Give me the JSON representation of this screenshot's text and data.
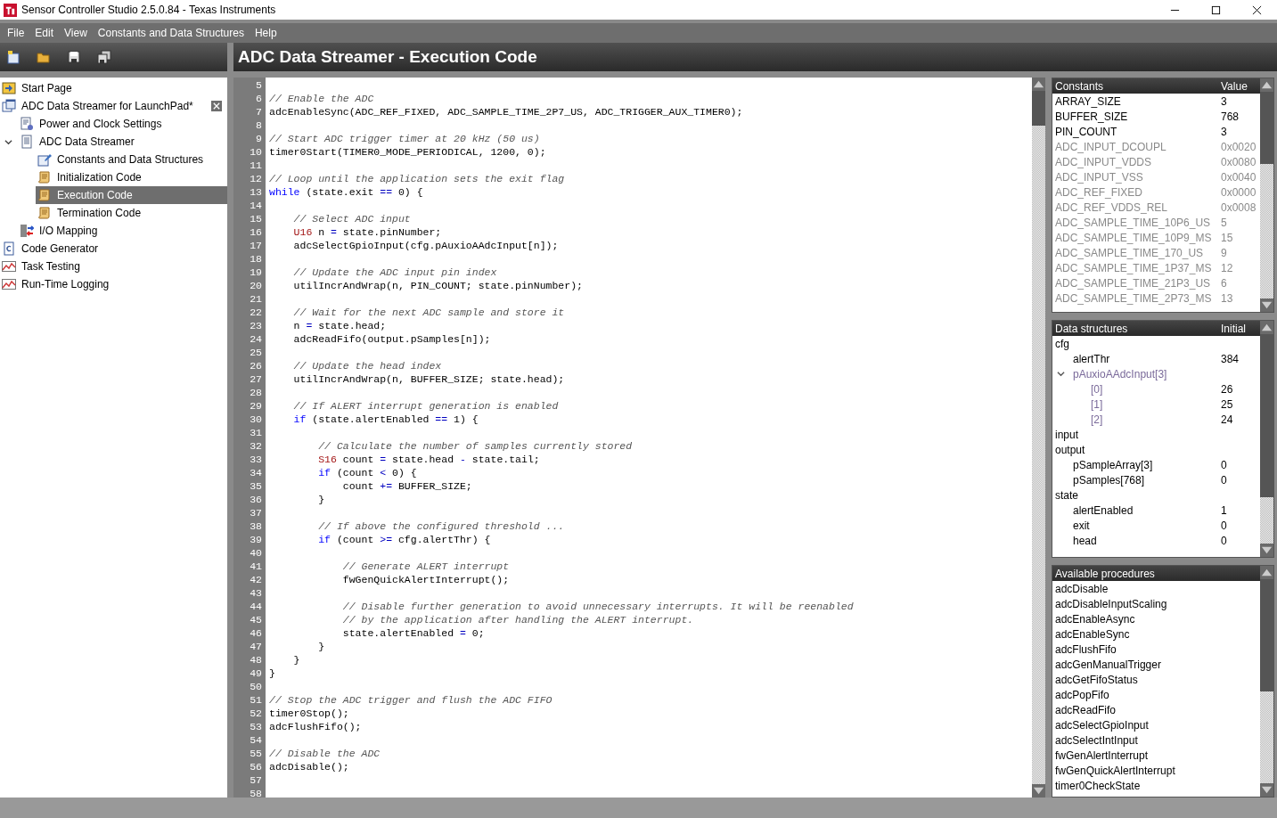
{
  "window": {
    "title": "Sensor Controller Studio 2.5.0.84 - Texas Instruments"
  },
  "menu": [
    "File",
    "Edit",
    "View",
    "Constants and Data Structures",
    "Help"
  ],
  "editor_title": "ADC Data Streamer - Execution Code",
  "project_tree": [
    {
      "label": "Start Page",
      "kind": "page",
      "selected": false
    },
    {
      "label": "ADC Data Streamer for LaunchPad*",
      "kind": "project",
      "selected": false,
      "closable": true,
      "children": [
        {
          "label": "Power and Clock Settings",
          "kind": "settings",
          "selected": false
        },
        {
          "label": "ADC Data Streamer",
          "kind": "task",
          "selected": false,
          "expanded": true,
          "children": [
            {
              "label": "Constants and Data Structures",
              "kind": "constants",
              "selected": false
            },
            {
              "label": "Initialization Code",
              "kind": "code",
              "selected": false
            },
            {
              "label": "Execution Code",
              "kind": "code",
              "selected": true
            },
            {
              "label": "Termination Code",
              "kind": "code",
              "selected": false
            }
          ]
        },
        {
          "label": "I/O Mapping",
          "kind": "mapping",
          "selected": false
        }
      ]
    },
    {
      "label": "Code Generator",
      "kind": "generator",
      "selected": false
    },
    {
      "label": "Task Testing",
      "kind": "chart",
      "selected": false
    },
    {
      "label": "Run-Time Logging",
      "kind": "chart",
      "selected": false
    }
  ],
  "code_lines": [
    {
      "n": "5"
    },
    {
      "n": "6",
      "segs": [
        {
          "kind": "comment",
          "text": "// Enable the ADC"
        }
      ]
    },
    {
      "n": "7",
      "segs": [
        {
          "kind": "plain",
          "text": "adcEnableSync(ADC_REF_FIXED, ADC_SAMPLE_TIME_2P7_US, ADC_TRIGGER_AUX_TIMER0);"
        }
      ]
    },
    {
      "n": "8"
    },
    {
      "n": "9",
      "segs": [
        {
          "kind": "comment",
          "text": "// Start ADC trigger timer at 20 kHz (50 us)"
        }
      ]
    },
    {
      "n": "10",
      "segs": [
        {
          "kind": "plain",
          "text": "timer0Start(TIMER0_MODE_PERIODICAL, 1200, 0);"
        }
      ]
    },
    {
      "n": "11"
    },
    {
      "n": "12",
      "segs": [
        {
          "kind": "comment",
          "text": "// Loop until the application sets the exit flag"
        }
      ]
    },
    {
      "n": "13",
      "segs": [
        {
          "kind": "keyword",
          "text": "while"
        },
        {
          "kind": "plain",
          "text": " (state.exit "
        },
        {
          "kind": "operator",
          "text": "=="
        },
        {
          "kind": "plain",
          "text": " 0) {"
        }
      ]
    },
    {
      "n": "14"
    },
    {
      "n": "15",
      "segs": [
        {
          "kind": "comment",
          "text": "    // Select ADC input"
        }
      ]
    },
    {
      "n": "16",
      "segs": [
        {
          "kind": "type",
          "text": "    U16"
        },
        {
          "kind": "plain",
          "text": " n "
        },
        {
          "kind": "operator",
          "text": "="
        },
        {
          "kind": "plain",
          "text": " state.pinNumber;"
        }
      ]
    },
    {
      "n": "17",
      "segs": [
        {
          "kind": "plain",
          "text": "    adcSelectGpioInput(cfg.pAuxioAAdcInput[n]);"
        }
      ]
    },
    {
      "n": "18"
    },
    {
      "n": "19",
      "segs": [
        {
          "kind": "comment",
          "text": "    // Update the ADC input pin index"
        }
      ]
    },
    {
      "n": "20",
      "segs": [
        {
          "kind": "plain",
          "text": "    utilIncrAndWrap(n, PIN_COUNT; state.pinNumber);"
        }
      ]
    },
    {
      "n": "21"
    },
    {
      "n": "22",
      "segs": [
        {
          "kind": "comment",
          "text": "    // Wait for the next ADC sample and store it"
        }
      ]
    },
    {
      "n": "23",
      "segs": [
        {
          "kind": "plain",
          "text": "    n "
        },
        {
          "kind": "operator",
          "text": "="
        },
        {
          "kind": "plain",
          "text": " state.head;"
        }
      ]
    },
    {
      "n": "24",
      "segs": [
        {
          "kind": "plain",
          "text": "    adcReadFifo(output.pSamples[n]);"
        }
      ]
    },
    {
      "n": "25"
    },
    {
      "n": "26",
      "segs": [
        {
          "kind": "comment",
          "text": "    // Update the head index"
        }
      ]
    },
    {
      "n": "27",
      "segs": [
        {
          "kind": "plain",
          "text": "    utilIncrAndWrap(n, BUFFER_SIZE; state.head);"
        }
      ]
    },
    {
      "n": "28"
    },
    {
      "n": "29",
      "segs": [
        {
          "kind": "comment",
          "text": "    // If ALERT interrupt generation is enabled"
        }
      ]
    },
    {
      "n": "30",
      "segs": [
        {
          "kind": "keyword",
          "text": "    if"
        },
        {
          "kind": "plain",
          "text": " (state.alertEnabled "
        },
        {
          "kind": "operator",
          "text": "=="
        },
        {
          "kind": "plain",
          "text": " 1) {"
        }
      ]
    },
    {
      "n": "31"
    },
    {
      "n": "32",
      "segs": [
        {
          "kind": "comment",
          "text": "        // Calculate the number of samples currently stored"
        }
      ]
    },
    {
      "n": "33",
      "segs": [
        {
          "kind": "type",
          "text": "        S16"
        },
        {
          "kind": "plain",
          "text": " count "
        },
        {
          "kind": "operator",
          "text": "="
        },
        {
          "kind": "plain",
          "text": " state.head "
        },
        {
          "kind": "operator",
          "text": "-"
        },
        {
          "kind": "plain",
          "text": " state.tail;"
        }
      ]
    },
    {
      "n": "34",
      "segs": [
        {
          "kind": "keyword",
          "text": "        if"
        },
        {
          "kind": "plain",
          "text": " (count "
        },
        {
          "kind": "operator",
          "text": "<"
        },
        {
          "kind": "plain",
          "text": " 0) {"
        }
      ]
    },
    {
      "n": "35",
      "segs": [
        {
          "kind": "plain",
          "text": "            count "
        },
        {
          "kind": "operator",
          "text": "+="
        },
        {
          "kind": "plain",
          "text": " BUFFER_SIZE;"
        }
      ]
    },
    {
      "n": "36",
      "segs": [
        {
          "kind": "plain",
          "text": "        }"
        }
      ]
    },
    {
      "n": "37"
    },
    {
      "n": "38",
      "segs": [
        {
          "kind": "comment",
          "text": "        // If above the configured threshold ..."
        }
      ]
    },
    {
      "n": "39",
      "segs": [
        {
          "kind": "keyword",
          "text": "        if"
        },
        {
          "kind": "plain",
          "text": " (count "
        },
        {
          "kind": "operator",
          "text": ">="
        },
        {
          "kind": "plain",
          "text": " cfg.alertThr) {"
        }
      ]
    },
    {
      "n": "40"
    },
    {
      "n": "41",
      "segs": [
        {
          "kind": "comment",
          "text": "            // Generate ALERT interrupt"
        }
      ]
    },
    {
      "n": "42",
      "segs": [
        {
          "kind": "plain",
          "text": "            fwGenQuickAlertInterrupt();"
        }
      ]
    },
    {
      "n": "43"
    },
    {
      "n": "44",
      "segs": [
        {
          "kind": "comment",
          "text": "            // Disable further generation to avoid unnecessary interrupts. It will be reenabled"
        }
      ]
    },
    {
      "n": "45",
      "segs": [
        {
          "kind": "comment",
          "text": "            // by the application after handling the ALERT interrupt."
        }
      ]
    },
    {
      "n": "46",
      "segs": [
        {
          "kind": "plain",
          "text": "            state.alertEnabled "
        },
        {
          "kind": "operator",
          "text": "="
        },
        {
          "kind": "plain",
          "text": " 0;"
        }
      ]
    },
    {
      "n": "47",
      "segs": [
        {
          "kind": "plain",
          "text": "        }"
        }
      ]
    },
    {
      "n": "48",
      "segs": [
        {
          "kind": "plain",
          "text": "    }"
        }
      ]
    },
    {
      "n": "49",
      "segs": [
        {
          "kind": "plain",
          "text": "}"
        }
      ]
    },
    {
      "n": "50"
    },
    {
      "n": "51",
      "segs": [
        {
          "kind": "comment",
          "text": "// Stop the ADC trigger and flush the ADC FIFO"
        }
      ]
    },
    {
      "n": "52",
      "segs": [
        {
          "kind": "plain",
          "text": "timer0Stop();"
        }
      ]
    },
    {
      "n": "53",
      "segs": [
        {
          "kind": "plain",
          "text": "adcFlushFifo();"
        }
      ]
    },
    {
      "n": "54"
    },
    {
      "n": "55",
      "segs": [
        {
          "kind": "comment",
          "text": "// Disable the ADC"
        }
      ]
    },
    {
      "n": "56",
      "segs": [
        {
          "kind": "plain",
          "text": "adcDisable();"
        }
      ]
    },
    {
      "n": "57"
    },
    {
      "n": "58"
    }
  ],
  "constants": {
    "columns": [
      "Constants",
      "Value"
    ],
    "rows": [
      {
        "name": "ARRAY_SIZE",
        "value": "3",
        "builtin": false
      },
      {
        "name": "BUFFER_SIZE",
        "value": "768",
        "builtin": false
      },
      {
        "name": "PIN_COUNT",
        "value": "3",
        "builtin": false
      },
      {
        "name": "ADC_INPUT_DCOUPL",
        "value": "0x0020",
        "builtin": true
      },
      {
        "name": "ADC_INPUT_VDDS",
        "value": "0x0080",
        "builtin": true
      },
      {
        "name": "ADC_INPUT_VSS",
        "value": "0x0040",
        "builtin": true
      },
      {
        "name": "ADC_REF_FIXED",
        "value": "0x0000",
        "builtin": true
      },
      {
        "name": "ADC_REF_VDDS_REL",
        "value": "0x0008",
        "builtin": true
      },
      {
        "name": "ADC_SAMPLE_TIME_10P6_US",
        "value": "5",
        "builtin": true
      },
      {
        "name": "ADC_SAMPLE_TIME_10P9_MS",
        "value": "15",
        "builtin": true
      },
      {
        "name": "ADC_SAMPLE_TIME_170_US",
        "value": "9",
        "builtin": true
      },
      {
        "name": "ADC_SAMPLE_TIME_1P37_MS",
        "value": "12",
        "builtin": true
      },
      {
        "name": "ADC_SAMPLE_TIME_21P3_US",
        "value": "6",
        "builtin": true
      },
      {
        "name": "ADC_SAMPLE_TIME_2P73_MS",
        "value": "13",
        "builtin": true
      }
    ]
  },
  "data_structures": {
    "columns": [
      "Data structures",
      "Initial"
    ],
    "nodes": [
      {
        "name": "cfg",
        "dimmed": false,
        "children": [
          {
            "name": "alertThr",
            "value": "384",
            "dimmed": false
          },
          {
            "name": "pAuxioAAdcInput[3]",
            "dimmed": true,
            "expanded": true,
            "children": [
              {
                "name": "[0]",
                "value": "26",
                "dimmed": true
              },
              {
                "name": "[1]",
                "value": "25",
                "dimmed": true
              },
              {
                "name": "[2]",
                "value": "24",
                "dimmed": true
              }
            ]
          }
        ]
      },
      {
        "name": "input",
        "dimmed": false
      },
      {
        "name": "output",
        "dimmed": false,
        "children": [
          {
            "name": "pSampleArray[3]",
            "value": "0",
            "dimmed": false
          },
          {
            "name": "pSamples[768]",
            "value": "0",
            "dimmed": false
          }
        ]
      },
      {
        "name": "state",
        "dimmed": false,
        "children": [
          {
            "name": "alertEnabled",
            "value": "1",
            "dimmed": false
          },
          {
            "name": "exit",
            "value": "0",
            "dimmed": false
          },
          {
            "name": "head",
            "value": "0",
            "dimmed": false
          }
        ]
      }
    ]
  },
  "procedures": {
    "title": "Available procedures",
    "items": [
      "adcDisable",
      "adcDisableInputScaling",
      "adcEnableAsync",
      "adcEnableSync",
      "adcFlushFifo",
      "adcGenManualTrigger",
      "adcGetFifoStatus",
      "adcPopFifo",
      "adcReadFifo",
      "adcSelectGpioInput",
      "adcSelectIntInput",
      "fwGenAlertInterrupt",
      "fwGenQuickAlertInterrupt",
      "timer0CheckState"
    ]
  }
}
